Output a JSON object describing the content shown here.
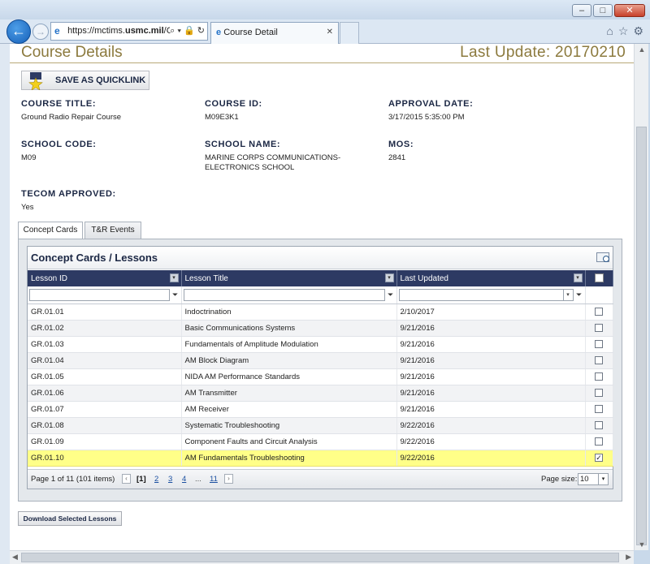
{
  "browser": {
    "url_prefix": "https://mctims.",
    "url_host": "usmc.mil",
    "url_suffix": "/Cu",
    "address_tools": "⌕ ▾ 🔒 ↻",
    "tab_title": "Course Detail",
    "tab_close": "✕",
    "window_buttons": {
      "minimize": "–",
      "maximize": "□",
      "close": "✕"
    },
    "nav": {
      "back": "←",
      "forward": "→",
      "home": "⌂",
      "favorites": "☆",
      "tools": "⚙"
    }
  },
  "header": {
    "title": "Course Details",
    "last_update": "Last Update: 20170210"
  },
  "quicklink": {
    "label": "SAVE AS QUICKLINK"
  },
  "fields": {
    "course_title": {
      "label": "COURSE TITLE:",
      "value": "Ground Radio Repair Course"
    },
    "course_id": {
      "label": "COURSE ID:",
      "value": "M09E3K1"
    },
    "approval_date": {
      "label": "APPROVAL DATE:",
      "value": "3/17/2015 5:35:00 PM"
    },
    "school_code": {
      "label": "SCHOOL CODE:",
      "value": "M09"
    },
    "school_name": {
      "label": "SCHOOL NAME:",
      "value_line1": "MARINE CORPS COMMUNICATIONS-",
      "value_line2": "ELECTRONICS SCHOOL"
    },
    "mos": {
      "label": "MOS:",
      "value": "2841"
    },
    "tecom_approved": {
      "label": "TECOM APPROVED:",
      "value": "Yes"
    }
  },
  "tabs": [
    {
      "label": "Concept Cards",
      "active": true
    },
    {
      "label": "T&R Events",
      "active": false
    }
  ],
  "grid": {
    "title": "Concept Cards / Lessons",
    "columns": [
      "Lesson ID",
      "Lesson Title",
      "Last Updated"
    ],
    "rows": [
      {
        "id": "GR.01.01",
        "title": "Indoctrination",
        "updated": "2/10/2017",
        "checked": false
      },
      {
        "id": "GR.01.02",
        "title": "Basic Communications Systems",
        "updated": "9/21/2016",
        "checked": false
      },
      {
        "id": "GR.01.03",
        "title": "Fundamentals of Amplitude Modulation",
        "updated": "9/21/2016",
        "checked": false
      },
      {
        "id": "GR.01.04",
        "title": "AM Block Diagram",
        "updated": "9/21/2016",
        "checked": false
      },
      {
        "id": "GR.01.05",
        "title": "NIDA AM Performance Standards",
        "updated": "9/21/2016",
        "checked": false
      },
      {
        "id": "GR.01.06",
        "title": "AM Transmitter",
        "updated": "9/21/2016",
        "checked": false
      },
      {
        "id": "GR.01.07",
        "title": "AM Receiver",
        "updated": "9/21/2016",
        "checked": false
      },
      {
        "id": "GR.01.08",
        "title": "Systematic Troubleshooting",
        "updated": "9/22/2016",
        "checked": false
      },
      {
        "id": "GR.01.09",
        "title": "Component Faults and Circuit Analysis",
        "updated": "9/22/2016",
        "checked": false
      },
      {
        "id": "GR.01.10",
        "title": "AM Fundamentals Troubleshooting",
        "updated": "9/22/2016",
        "checked": true
      }
    ],
    "pager": {
      "info": "Page 1 of 11 (101 items)",
      "prev": "‹",
      "next": "›",
      "current": "[1]",
      "pages": [
        "2",
        "3",
        "4"
      ],
      "ellipsis": "...",
      "last": "11",
      "page_size_label": "Page size:",
      "page_size": "10"
    }
  },
  "download": {
    "label": "Download Selected Lessons"
  },
  "colors": {
    "header_text": "#8c7a3e",
    "grid_header_bg": "#2d3a63",
    "selected_row": "#ffff88"
  }
}
